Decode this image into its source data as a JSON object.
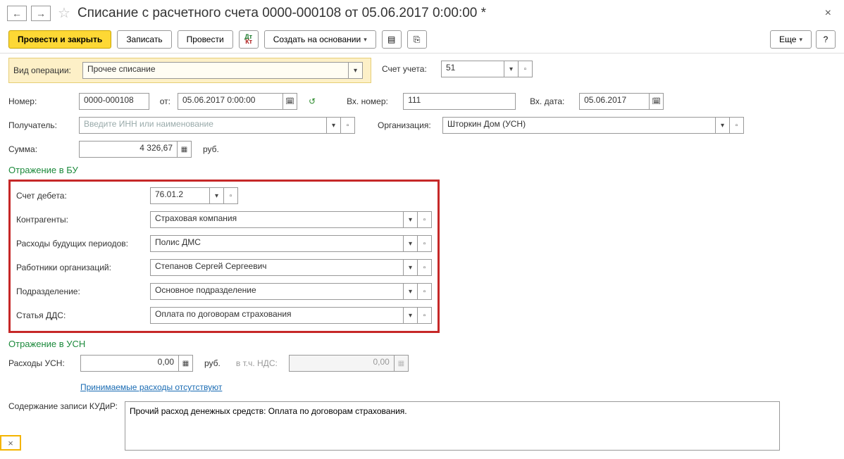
{
  "header": {
    "title": "Списание с расчетного счета 0000-000108 от 05.06.2017 0:00:00 *"
  },
  "toolbar": {
    "post_close": "Провести и закрыть",
    "save": "Записать",
    "post": "Провести",
    "create_based": "Создать на основании",
    "more": "Еще",
    "help": "?"
  },
  "op": {
    "label_type": "Вид операции:",
    "type_value": "Прочее списание",
    "label_account": "Счет учета:",
    "account_value": "51"
  },
  "doc": {
    "label_number": "Номер:",
    "number": "0000-000108",
    "label_from": "от:",
    "date": "05.06.2017  0:00:00",
    "label_inno": "Вх. номер:",
    "inno": "111",
    "label_indate": "Вх. дата:",
    "indate": "05.06.2017"
  },
  "recipient": {
    "label": "Получатель:",
    "placeholder": "Введите ИНН или наименование",
    "label_org": "Организация:",
    "org_value": "Шторкин Дом (УСН)"
  },
  "sum": {
    "label": "Сумма:",
    "value": "4 326,67",
    "unit": "руб."
  },
  "section_bu": "Отражение в БУ",
  "bu": {
    "label_debit": "Счет дебета:",
    "debit": "76.01.2",
    "label_counterparty": "Контрагенты:",
    "counterparty": "Страховая компания",
    "label_deferred": "Расходы будущих периодов:",
    "deferred": "Полис ДМС",
    "label_employee": "Работники организаций:",
    "employee": "Степанов Сергей Сергеевич",
    "label_division": "Подразделение:",
    "division": "Основное подразделение",
    "label_dds": "Статья ДДС:",
    "dds": "Оплата по договорам страхования"
  },
  "section_usn": "Отражение в УСН",
  "usn": {
    "label_exp": "Расходы УСН:",
    "exp_value": "0,00",
    "unit": "руб.",
    "vat_label": "в т.ч. НДС:",
    "vat_value": "0,00",
    "link_text": "Принимаемые расходы отсутствуют"
  },
  "kudir": {
    "label": "Содержание записи КУДиР:",
    "text": "Прочий расход денежных средств: Оплата по договорам страхования."
  },
  "tabcorner": "×"
}
